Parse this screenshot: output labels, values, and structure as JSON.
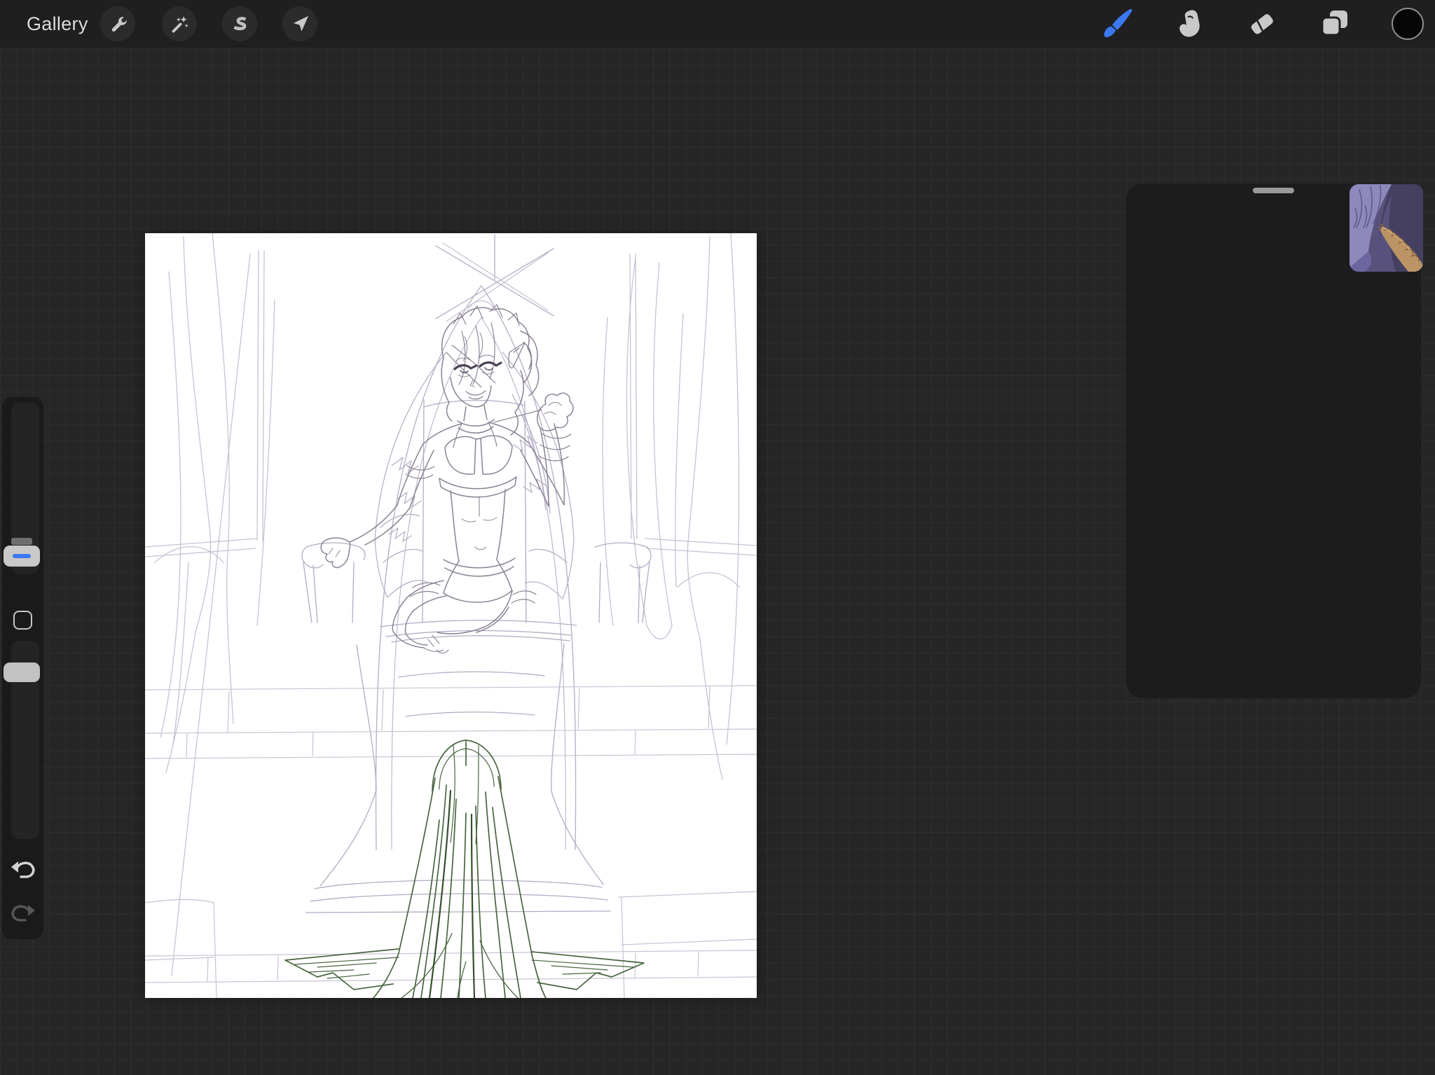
{
  "topbar": {
    "gallery_label": "Gallery",
    "left_tools": [
      {
        "name": "actions",
        "icon": "wrench-icon"
      },
      {
        "name": "adjustments",
        "icon": "magic-wand-icon"
      },
      {
        "name": "selection",
        "icon": "selection-s-icon"
      },
      {
        "name": "transform",
        "icon": "transform-arrow-icon"
      }
    ],
    "right_tools": [
      {
        "name": "paint",
        "icon": "paintbrush-icon",
        "active": true
      },
      {
        "name": "smudge",
        "icon": "smudge-finger-icon",
        "active": false
      },
      {
        "name": "erase",
        "icon": "eraser-icon",
        "active": false
      },
      {
        "name": "layers",
        "icon": "layers-icon",
        "active": false
      },
      {
        "name": "color",
        "icon": "color-circle-icon",
        "current_color": "#060606"
      }
    ],
    "accent_color": "#3B78F2",
    "bar_color": "#1F1F20"
  },
  "sidebar": {
    "brush_size_slider": {
      "handle_position": "near-bottom",
      "accent_color": "#3B78F2"
    },
    "opacity_slider": {
      "handle_position": "near-top"
    },
    "modify_button": {
      "shape": "rounded-square-outline"
    },
    "undo_enabled": true,
    "redo_enabled": false
  },
  "canvas": {
    "background": "#FFFFFF",
    "content_description": "pencil sketch: winged character seated on a throne between drapes, steps in front, long-haired figure in dark green seen from behind in the foreground",
    "sketch_colors": {
      "light_underlay": "#C7C1D5",
      "mid_lines": "#B3ABC4",
      "figure_lines": "#8B8295",
      "dark_accents": "#4A4254",
      "green_sketch": "#47653F",
      "green_dark": "#34512E"
    }
  },
  "floating_panel": {
    "drag_handle": true,
    "background": "#1C1C1D",
    "thumbnail": {
      "description": "painted detail: purple wing feathers and golden braid",
      "colors": [
        "#8E89BB",
        "#454060",
        "#BB9465"
      ]
    }
  },
  "workspace": {
    "background": "#262626",
    "grid_line_color": "#2F2F2F"
  }
}
